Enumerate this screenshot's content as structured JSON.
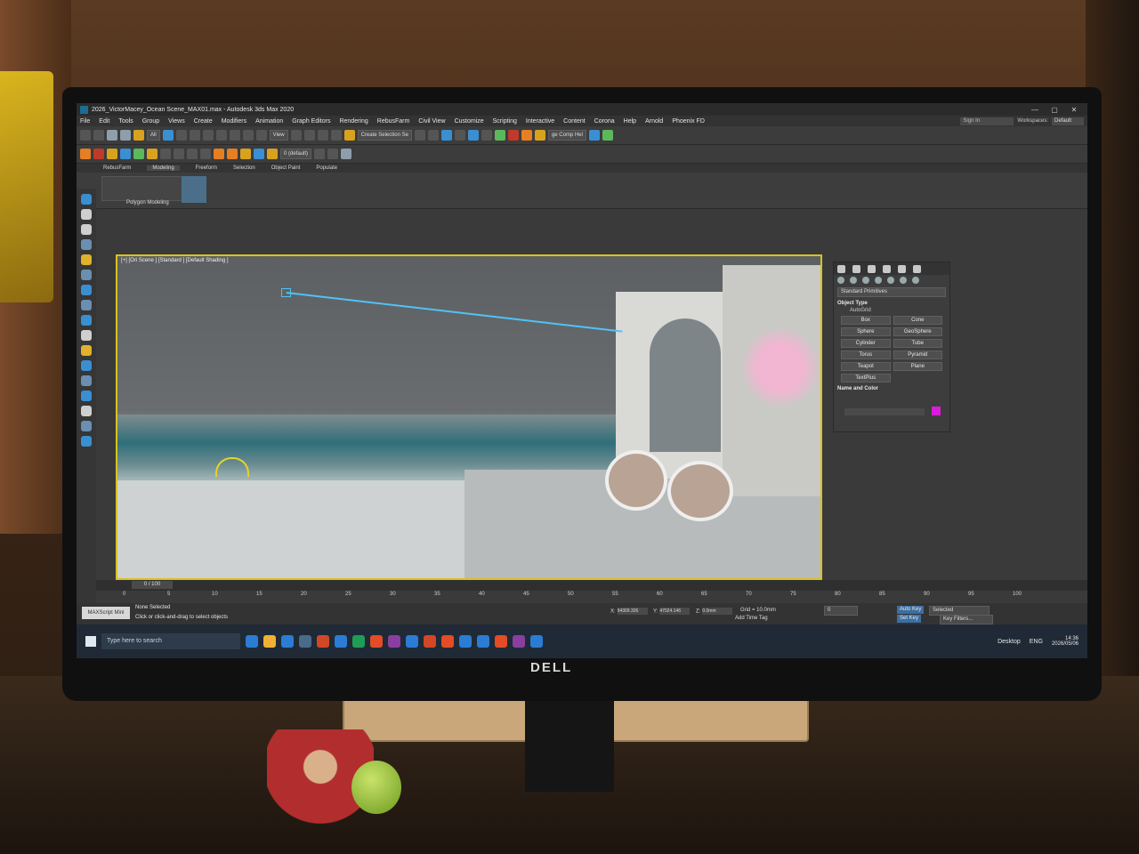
{
  "window": {
    "title": "2026_VictorMacey_Ocean Scene_MAX01.max - Autodesk 3ds Max 2020",
    "min": "—",
    "max": "▢",
    "close": "✕"
  },
  "menu": {
    "items": [
      "File",
      "Edit",
      "Tools",
      "Group",
      "Views",
      "Create",
      "Modifiers",
      "Animation",
      "Graph Editors",
      "Rendering",
      "RebusFarm",
      "Civil View",
      "Customize",
      "Scripting",
      "Interactive",
      "Content",
      "Corona",
      "Help",
      "Arnold",
      "Phoenix FD"
    ],
    "signin": "Sign In",
    "workspaces_label": "Workspaces:",
    "workspaces_value": "Default"
  },
  "toolbar": {
    "filter": "All",
    "view": "View",
    "selection_set": "Create Selection Se",
    "layer": "0 (default)",
    "comp": "ge Comp Hel"
  },
  "ribbon": {
    "tabs": [
      "RebusFarm",
      "Modeling",
      "Freeform",
      "Selection",
      "Object Paint",
      "Populate"
    ],
    "panel_label": "Polygon Modeling"
  },
  "viewport": {
    "label": "[+] [Ori Scene ] [Standard ] [Default Shading ]"
  },
  "command_panel": {
    "dropdown": "Standard Primitives",
    "object_type": "Object Type",
    "autogrid": "AutoGrid",
    "primitives": [
      "Box",
      "Cone",
      "Sphere",
      "GeoSphere",
      "Cylinder",
      "Tube",
      "Torus",
      "Pyramid",
      "Teapot",
      "Plane",
      "TextPlus"
    ],
    "name_color": "Name and Color"
  },
  "timeline": {
    "slider": "0 / 100",
    "ticks": [
      "0",
      "5",
      "10",
      "15",
      "20",
      "25",
      "30",
      "35",
      "40",
      "45",
      "50",
      "55",
      "60",
      "65",
      "70",
      "75",
      "80",
      "85",
      "90",
      "95",
      "100"
    ]
  },
  "status": {
    "maxscript": "MAXScript Mini",
    "selection": "None Selected",
    "prompt": "Click or click-and-drag to select objects",
    "x_label": "X:",
    "x_value": "94309.326",
    "y_label": "Y:",
    "y_value": "47024.146",
    "z_label": "Z:",
    "z_value": "0.0mm",
    "grid": "Grid = 10.0mm",
    "add_time_tag": "Add Time Tag",
    "auto_key": "Auto Key",
    "selected": "Selected",
    "set_key": "Set Key",
    "key_filters": "Key Filters...",
    "frame": "0"
  },
  "taskbar": {
    "search": "Type here to search",
    "desktop": "Desktop",
    "lang": "ENG",
    "time": "14:36",
    "date": "2026/05/06"
  },
  "brand": "DELL",
  "colors": {
    "viewport_border": "#d9c21e",
    "camera": "#4fc3f7",
    "object_color": "#d61ed6"
  }
}
